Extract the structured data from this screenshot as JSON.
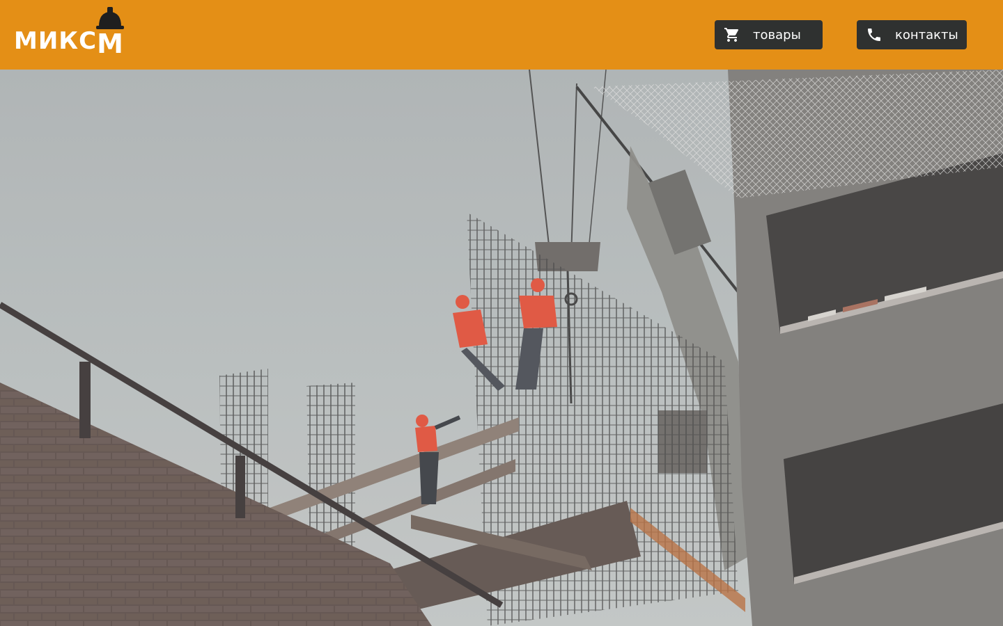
{
  "header": {
    "logo": {
      "text": "МИКС",
      "mark_letter": "M"
    },
    "nav": [
      {
        "label": "товары",
        "icon": "cart-icon"
      },
      {
        "label": "контакты",
        "icon": "phone-icon"
      }
    ]
  },
  "hero": {
    "image": "construction-site-photo",
    "description_icon": "photo"
  },
  "colors": {
    "header_bg": "#e48f16",
    "button_bg": "#2f3130",
    "text_light": "#ffffff"
  }
}
